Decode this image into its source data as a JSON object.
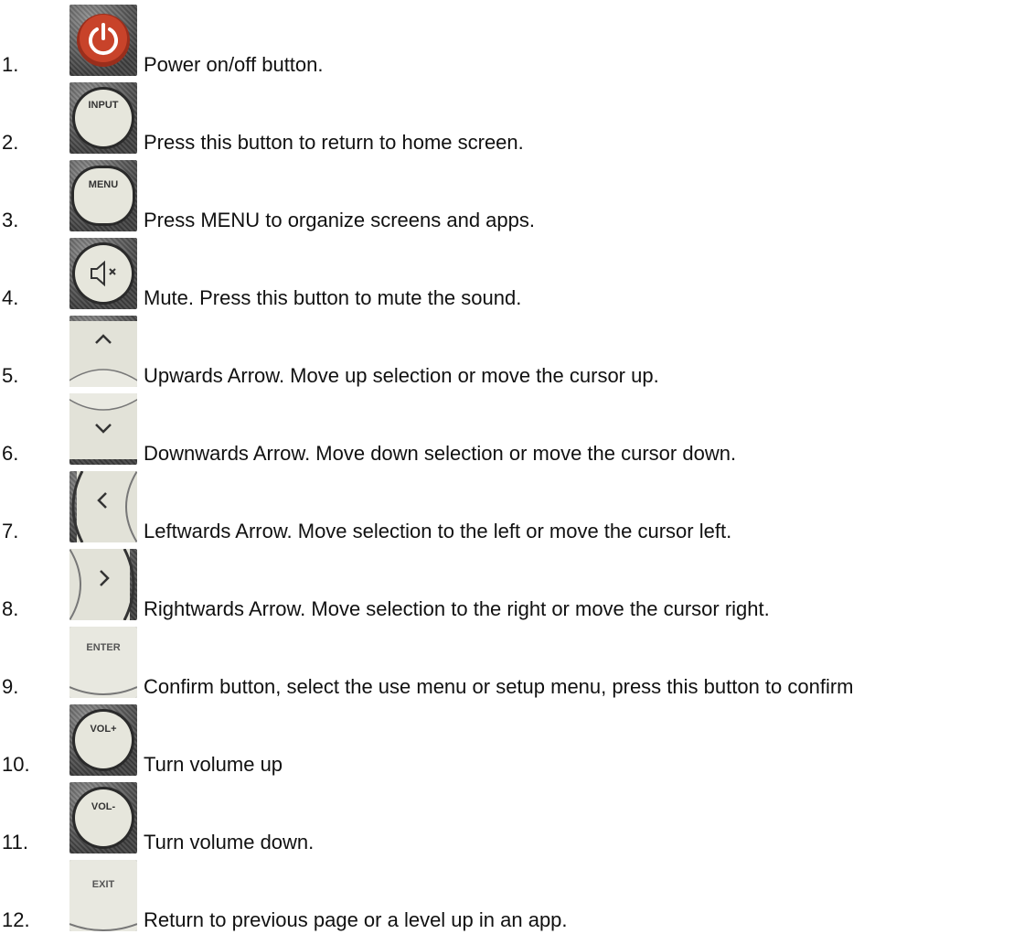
{
  "items": [
    {
      "number": "1.",
      "icon": "power-icon",
      "description": "Power on/off button."
    },
    {
      "number": "2.",
      "icon": "input-icon",
      "button_text": "INPUT",
      "description": "Press this button to return to home screen."
    },
    {
      "number": "3.",
      "icon": "menu-icon",
      "button_text": "MENU",
      "description": "Press MENU to organize screens and apps."
    },
    {
      "number": "4.",
      "icon": "mute-icon",
      "description": "Mute. Press this button to mute the sound."
    },
    {
      "number": "5.",
      "icon": "arrow-up-icon",
      "description": "Upwards Arrow. Move up selection or move the cursor up."
    },
    {
      "number": "6.",
      "icon": "arrow-down-icon",
      "description": "Downwards Arrow. Move down selection or move the cursor down."
    },
    {
      "number": "7.",
      "icon": "arrow-left-icon",
      "description": "Leftwards Arrow. Move selection to the left or move the cursor left."
    },
    {
      "number": "8.",
      "icon": "arrow-right-icon",
      "description": "Rightwards Arrow. Move selection to the right or move the cursor right."
    },
    {
      "number": "9.",
      "icon": "enter-icon",
      "button_text": "ENTER",
      "description": "Confirm button, select the use menu or setup menu, press this button to confirm"
    },
    {
      "number": "10.",
      "icon": "volume-up-icon",
      "button_text": "VOL+",
      "description": "Turn volume up"
    },
    {
      "number": "11.",
      "icon": "volume-down-icon",
      "button_text": "VOL-",
      "description": "Turn volume down."
    },
    {
      "number": "12.",
      "icon": "exit-icon",
      "button_text": "EXIT",
      "description": "Return to previous page or a level up in an app."
    }
  ],
  "colors": {
    "text": "#111111",
    "power": "#c8432a",
    "button_face": "#e6e6dc"
  }
}
